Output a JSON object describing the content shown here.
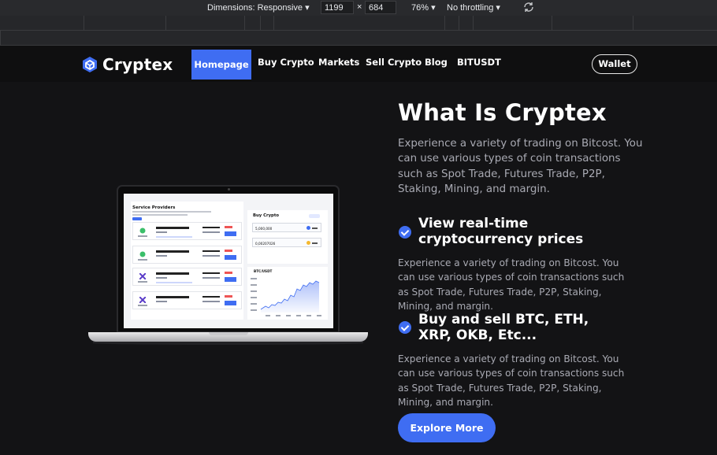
{
  "devtools": {
    "dimensions_label": "Dimensions: Responsive",
    "width": "1199",
    "times": "×",
    "height": "684",
    "zoom": "76%",
    "throttling": "No throttling",
    "rotate_icon": "rotate-icon"
  },
  "nav": {
    "brand": "Cryptex",
    "links": [
      "Homepage",
      "Buy Crypto",
      "Markets",
      "Sell Crypto",
      "Blog",
      "BITUSDT"
    ],
    "active_index": 0,
    "wallet_label": "Wallet"
  },
  "hero": {
    "title": "What Is Cryptex",
    "lead": "Experience a variety of trading on Bitcost. You can use various types of coin transactions such as Spot Trade, Futures Trade, P2P, Staking, Mining, and margin.",
    "features": [
      {
        "title": "View real-time cryptocurrency prices",
        "text": "Experience a variety of trading on Bitcost. You can use various types of coin transactions such as Spot Trade, Futures Trade, P2P, Staking, Mining, and margin."
      },
      {
        "title": "Buy and sell BTC, ETH, XRP, OKB, Etc...",
        "text": "Experience a variety of trading on Bitcost. You can use various types of coin transactions such as Spot Trade, Futures Trade, P2P, Staking, Mining, and margin."
      }
    ],
    "cta_label": "Explore More"
  },
  "mockup": {
    "service_title": "Service Providers",
    "buy_title": "Buy Crypto",
    "amount_1": "5,000,000",
    "amount_2": "0,00207026",
    "chart_title": "BTC/USDT"
  },
  "colors": {
    "accent": "#3f6df2",
    "background": "#131315",
    "nav_bg": "#0f0f10",
    "muted_text": "#a9aab3"
  }
}
